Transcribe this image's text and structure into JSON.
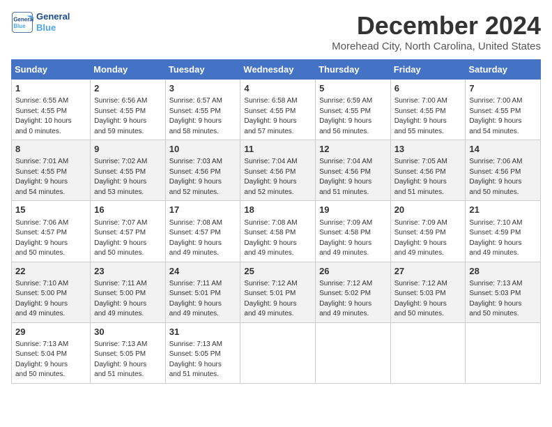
{
  "header": {
    "logo_line1": "General",
    "logo_line2": "Blue",
    "month_title": "December 2024",
    "location": "Morehead City, North Carolina, United States"
  },
  "days_of_week": [
    "Sunday",
    "Monday",
    "Tuesday",
    "Wednesday",
    "Thursday",
    "Friday",
    "Saturday"
  ],
  "weeks": [
    [
      {
        "day": "1",
        "info": "Sunrise: 6:55 AM\nSunset: 4:55 PM\nDaylight: 10 hours\nand 0 minutes."
      },
      {
        "day": "2",
        "info": "Sunrise: 6:56 AM\nSunset: 4:55 PM\nDaylight: 9 hours\nand 59 minutes."
      },
      {
        "day": "3",
        "info": "Sunrise: 6:57 AM\nSunset: 4:55 PM\nDaylight: 9 hours\nand 58 minutes."
      },
      {
        "day": "4",
        "info": "Sunrise: 6:58 AM\nSunset: 4:55 PM\nDaylight: 9 hours\nand 57 minutes."
      },
      {
        "day": "5",
        "info": "Sunrise: 6:59 AM\nSunset: 4:55 PM\nDaylight: 9 hours\nand 56 minutes."
      },
      {
        "day": "6",
        "info": "Sunrise: 7:00 AM\nSunset: 4:55 PM\nDaylight: 9 hours\nand 55 minutes."
      },
      {
        "day": "7",
        "info": "Sunrise: 7:00 AM\nSunset: 4:55 PM\nDaylight: 9 hours\nand 54 minutes."
      }
    ],
    [
      {
        "day": "8",
        "info": "Sunrise: 7:01 AM\nSunset: 4:55 PM\nDaylight: 9 hours\nand 54 minutes."
      },
      {
        "day": "9",
        "info": "Sunrise: 7:02 AM\nSunset: 4:55 PM\nDaylight: 9 hours\nand 53 minutes."
      },
      {
        "day": "10",
        "info": "Sunrise: 7:03 AM\nSunset: 4:56 PM\nDaylight: 9 hours\nand 52 minutes."
      },
      {
        "day": "11",
        "info": "Sunrise: 7:04 AM\nSunset: 4:56 PM\nDaylight: 9 hours\nand 52 minutes."
      },
      {
        "day": "12",
        "info": "Sunrise: 7:04 AM\nSunset: 4:56 PM\nDaylight: 9 hours\nand 51 minutes."
      },
      {
        "day": "13",
        "info": "Sunrise: 7:05 AM\nSunset: 4:56 PM\nDaylight: 9 hours\nand 51 minutes."
      },
      {
        "day": "14",
        "info": "Sunrise: 7:06 AM\nSunset: 4:56 PM\nDaylight: 9 hours\nand 50 minutes."
      }
    ],
    [
      {
        "day": "15",
        "info": "Sunrise: 7:06 AM\nSunset: 4:57 PM\nDaylight: 9 hours\nand 50 minutes."
      },
      {
        "day": "16",
        "info": "Sunrise: 7:07 AM\nSunset: 4:57 PM\nDaylight: 9 hours\nand 50 minutes."
      },
      {
        "day": "17",
        "info": "Sunrise: 7:08 AM\nSunset: 4:57 PM\nDaylight: 9 hours\nand 49 minutes."
      },
      {
        "day": "18",
        "info": "Sunrise: 7:08 AM\nSunset: 4:58 PM\nDaylight: 9 hours\nand 49 minutes."
      },
      {
        "day": "19",
        "info": "Sunrise: 7:09 AM\nSunset: 4:58 PM\nDaylight: 9 hours\nand 49 minutes."
      },
      {
        "day": "20",
        "info": "Sunrise: 7:09 AM\nSunset: 4:59 PM\nDaylight: 9 hours\nand 49 minutes."
      },
      {
        "day": "21",
        "info": "Sunrise: 7:10 AM\nSunset: 4:59 PM\nDaylight: 9 hours\nand 49 minutes."
      }
    ],
    [
      {
        "day": "22",
        "info": "Sunrise: 7:10 AM\nSunset: 5:00 PM\nDaylight: 9 hours\nand 49 minutes."
      },
      {
        "day": "23",
        "info": "Sunrise: 7:11 AM\nSunset: 5:00 PM\nDaylight: 9 hours\nand 49 minutes."
      },
      {
        "day": "24",
        "info": "Sunrise: 7:11 AM\nSunset: 5:01 PM\nDaylight: 9 hours\nand 49 minutes."
      },
      {
        "day": "25",
        "info": "Sunrise: 7:12 AM\nSunset: 5:01 PM\nDaylight: 9 hours\nand 49 minutes."
      },
      {
        "day": "26",
        "info": "Sunrise: 7:12 AM\nSunset: 5:02 PM\nDaylight: 9 hours\nand 49 minutes."
      },
      {
        "day": "27",
        "info": "Sunrise: 7:12 AM\nSunset: 5:03 PM\nDaylight: 9 hours\nand 50 minutes."
      },
      {
        "day": "28",
        "info": "Sunrise: 7:13 AM\nSunset: 5:03 PM\nDaylight: 9 hours\nand 50 minutes."
      }
    ],
    [
      {
        "day": "29",
        "info": "Sunrise: 7:13 AM\nSunset: 5:04 PM\nDaylight: 9 hours\nand 50 minutes."
      },
      {
        "day": "30",
        "info": "Sunrise: 7:13 AM\nSunset: 5:05 PM\nDaylight: 9 hours\nand 51 minutes."
      },
      {
        "day": "31",
        "info": "Sunrise: 7:13 AM\nSunset: 5:05 PM\nDaylight: 9 hours\nand 51 minutes."
      },
      {
        "day": "",
        "info": ""
      },
      {
        "day": "",
        "info": ""
      },
      {
        "day": "",
        "info": ""
      },
      {
        "day": "",
        "info": ""
      }
    ]
  ]
}
